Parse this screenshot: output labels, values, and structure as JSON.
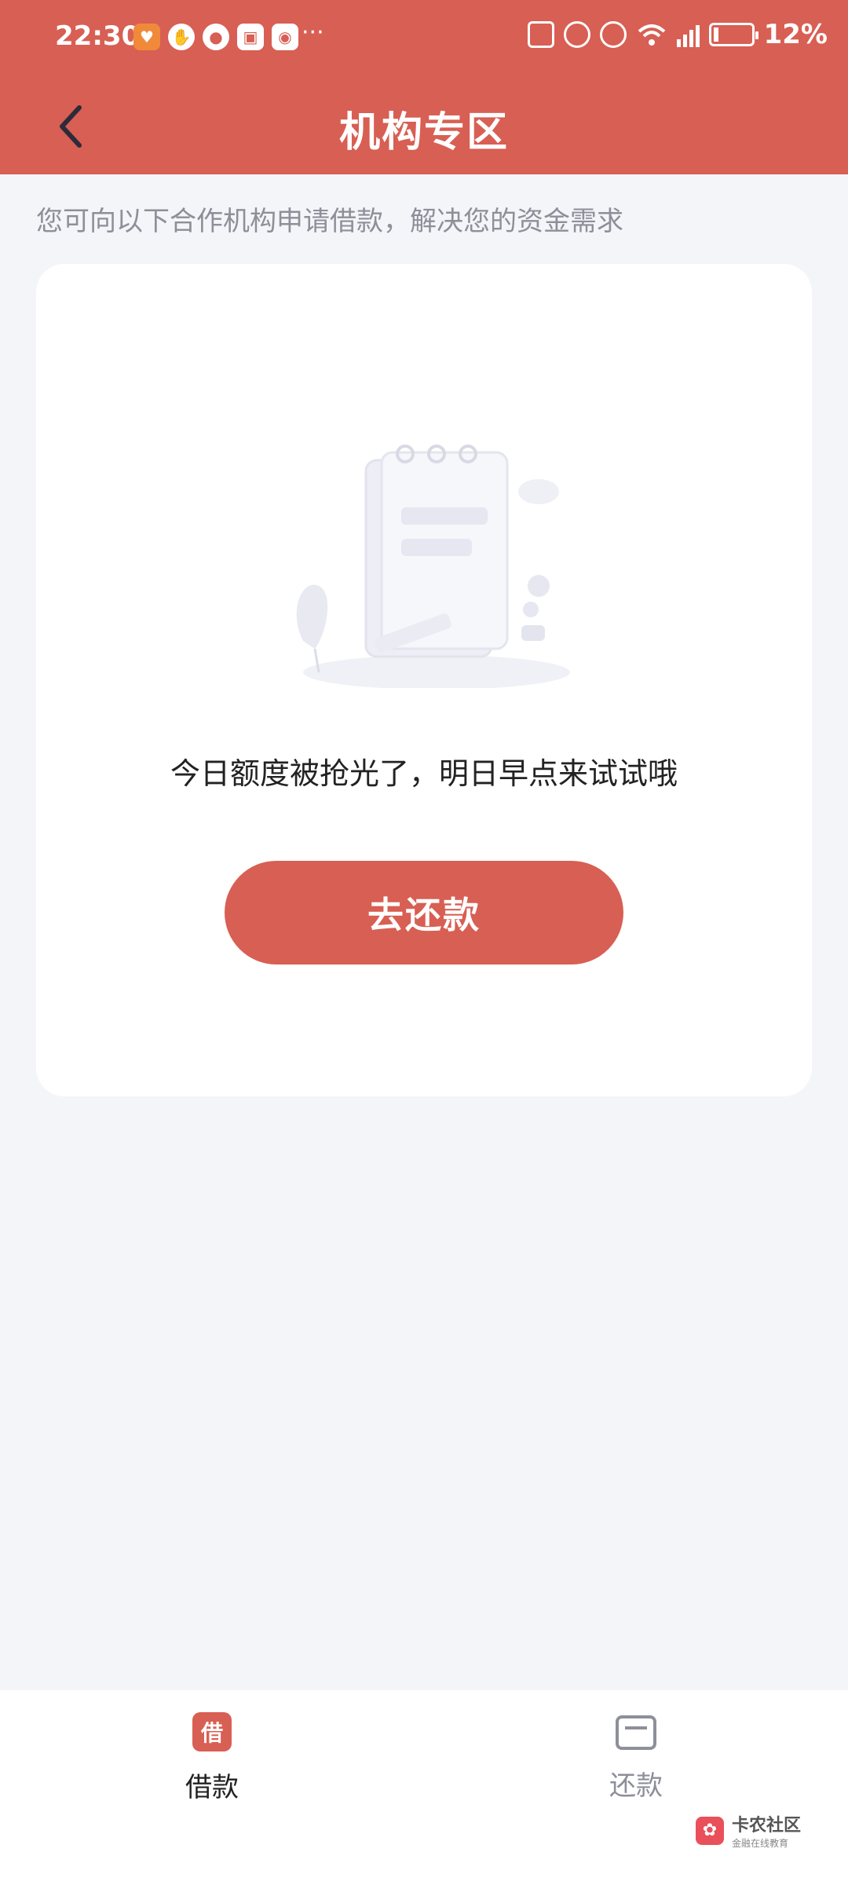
{
  "status_bar": {
    "time": "22:30",
    "dots": "···",
    "battery_percent": "12%",
    "battery_level": 0.12,
    "icons": [
      "bag-icon",
      "hand-icon",
      "chat-icon",
      "app-icon",
      "app-icon-2",
      "nfc-icon",
      "alarm-icon",
      "mute-icon",
      "wifi-icon",
      "5g-signal-icon",
      "battery-icon"
    ]
  },
  "header": {
    "title": "机构专区",
    "back_icon": "chevron-left-icon"
  },
  "subtitle": "您可向以下合作机构申请借款，解决您的资金需求",
  "card": {
    "empty_message": "今日额度被抢光了，明日早点来试试哦",
    "button_label": "去还款"
  },
  "bottom_nav": {
    "items": [
      {
        "label": "借款",
        "icon_text": "借",
        "active": true
      },
      {
        "label": "还款",
        "active": false
      }
    ]
  },
  "watermark": {
    "title": "卡农社区",
    "subtitle": "金融在线教育"
  },
  "colors": {
    "brand": "#d85f53",
    "background": "#f4f5f8",
    "muted_text": "#8d8f99"
  }
}
